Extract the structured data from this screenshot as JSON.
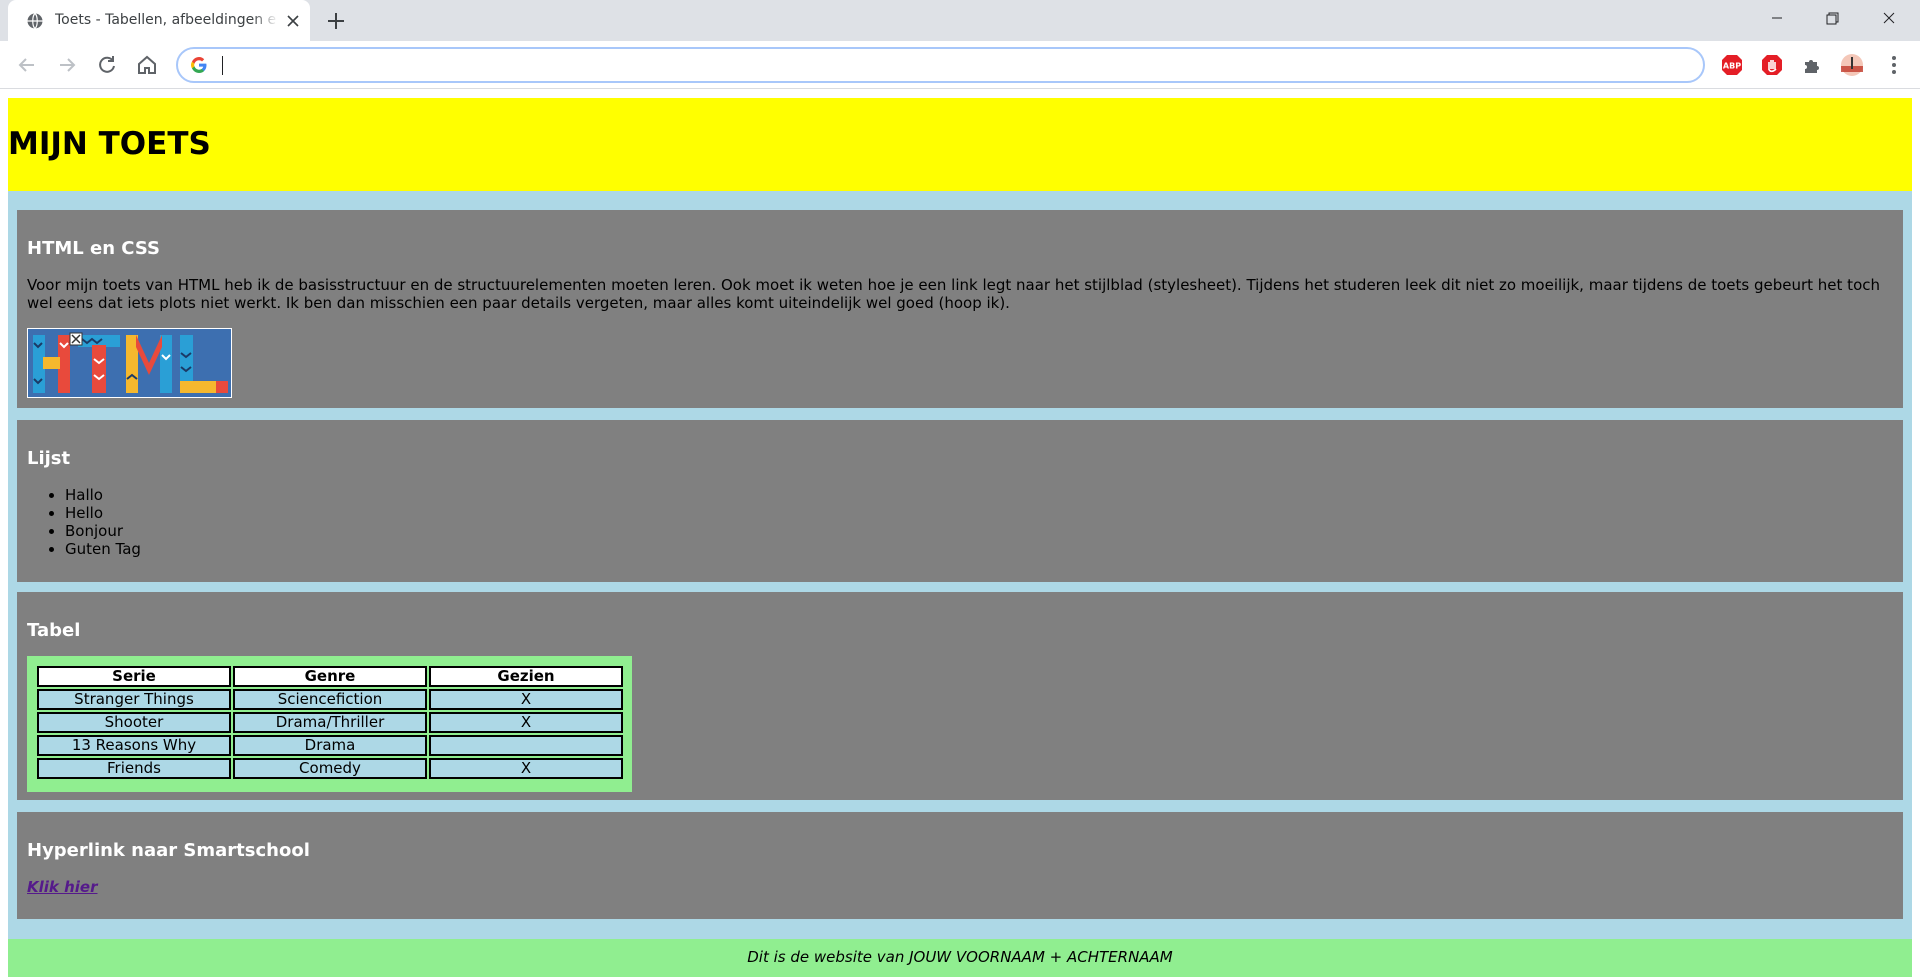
{
  "browser": {
    "tab_title": "Toets - Tabellen, afbeeldingen en lijsten",
    "address_value": "",
    "icons": {
      "favicon": "globe-icon",
      "close": "close-icon",
      "new_tab": "plus-icon",
      "back": "back-arrow-icon",
      "forward": "forward-arrow-icon",
      "reload": "reload-icon",
      "home": "home-icon",
      "search_engine": "google-g-icon",
      "extensions": [
        "adblock-plus-icon",
        "stop-hand-icon",
        "puzzle-icon",
        "profile-avatar-icon",
        "kebab-menu-icon"
      ]
    }
  },
  "page": {
    "title": "MIJN TOETS",
    "colors": {
      "header_bg": "#ffff00",
      "page_bg": "#add8e6",
      "section_bg": "#808080",
      "table_wrap_bg": "#90ee90",
      "footer_bg": "#90ee90",
      "link": "#551a8b"
    },
    "sections": {
      "html_css": {
        "heading": "HTML en CSS",
        "text": "Voor mijn toets van HTML heb ik de basisstructuur en de structuurelementen moeten leren. Ook moet ik weten hoe je een link legt naar het stijlblad (stylesheet). Tijdens het studeren leek dit niet zo moeilijk, maar tijdens de toets gebeurt het toch wel eens dat iets plots niet werkt. Ik ben dan misschien een paar details vergeten, maar alles komt uiteindelijk wel goed (hoop ik).",
        "image_text": "HTML"
      },
      "lijst": {
        "heading": "Lijst",
        "items": [
          "Hallo",
          "Hello",
          "Bonjour",
          "Guten Tag"
        ]
      },
      "tabel": {
        "heading": "Tabel",
        "columns": [
          "Serie",
          "Genre",
          "Gezien"
        ],
        "rows": [
          [
            "Stranger Things",
            "Sciencefiction",
            "X"
          ],
          [
            "Shooter",
            "Drama/Thriller",
            "X"
          ],
          [
            "13 Reasons Why",
            "Drama",
            ""
          ],
          [
            "Friends",
            "Comedy",
            "X"
          ]
        ]
      },
      "hyperlink": {
        "heading": "Hyperlink naar Smartschool",
        "link_text": "Klik hier"
      }
    },
    "footer": "Dit is de website van JOUW VOORNAAM + ACHTERNAAM"
  }
}
